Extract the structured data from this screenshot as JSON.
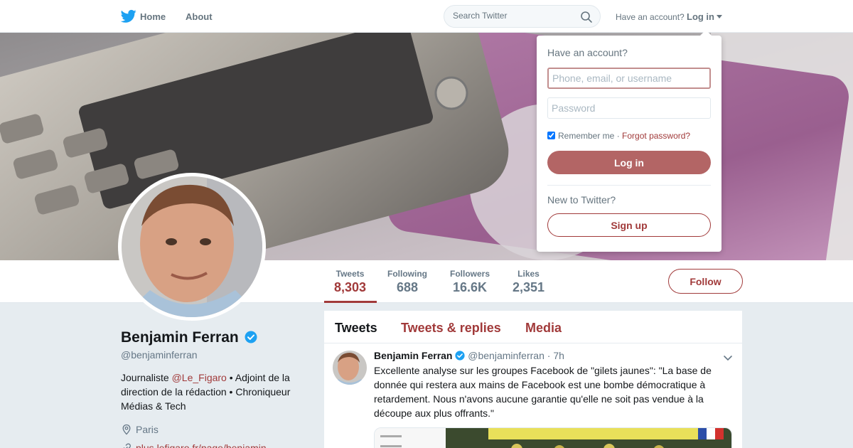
{
  "nav": {
    "logo_icon": "twitter-bird-icon",
    "home_label": "Home",
    "about_label": "About",
    "search_placeholder": "Search Twitter",
    "have_account_text": "Have an account?",
    "login_label": "Log in"
  },
  "profile_nav": {
    "stats": [
      {
        "label": "Tweets",
        "value": "8,303"
      },
      {
        "label": "Following",
        "value": "688"
      },
      {
        "label": "Followers",
        "value": "16.6K"
      },
      {
        "label": "Likes",
        "value": "2,351"
      }
    ],
    "follow_label": "Follow"
  },
  "profile": {
    "name": "Benjamin Ferran",
    "handle": "@benjaminferran",
    "bio_prefix": "Journaliste ",
    "bio_mention": "@Le_Figaro",
    "bio_suffix": " • Adjoint de la direction de la rédaction • Chroniqueur Médias & Tech",
    "location": "Paris",
    "url": "plus.lefigaro.fr/page/benjamin..."
  },
  "timeline": {
    "tabs": [
      {
        "label": "Tweets"
      },
      {
        "label": "Tweets & replies"
      },
      {
        "label": "Media"
      }
    ],
    "tweet": {
      "name": "Benjamin Ferran",
      "handle": "@benjaminferran",
      "separator": "·",
      "time": "7h",
      "text": "Excellente analyse sur les groupes Facebook de \"gilets jaunes\": \"La base de donnée qui restera aux mains de Facebook est une bombe démocratique à retardement. Nous n'avons aucune garantie qu'elle ne soit pas vendue à la découpe aux plus offrants.\""
    }
  },
  "login_dropdown": {
    "title": "Have an account?",
    "username_placeholder": "Phone, email, or username",
    "password_placeholder": "Password",
    "remember_label": "Remember me",
    "separator": "·",
    "forgot_label": "Forgot password?",
    "login_button": "Log in",
    "new_text": "New to Twitter?",
    "signup_button": "Sign up"
  },
  "colors": {
    "accent": "#a13a3a",
    "login_button_bg": "#b36565",
    "verified": "#1da1f2",
    "twitter_blue": "#1da1f2"
  }
}
